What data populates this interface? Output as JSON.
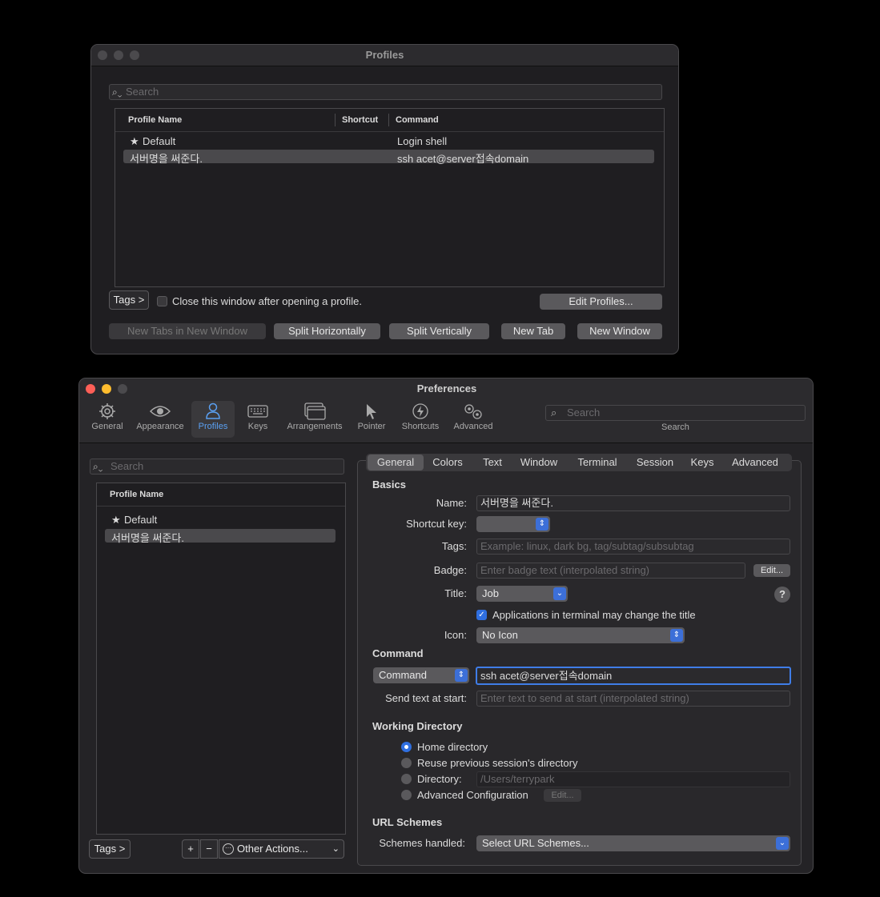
{
  "profiles_window": {
    "title": "Profiles",
    "search_placeholder": "Search",
    "columns": {
      "name": "Profile Name",
      "shortcut": "Shortcut",
      "command": "Command"
    },
    "rows": [
      {
        "star": "★",
        "name": "Default",
        "command": "Login shell"
      },
      {
        "name": "서버명을 써준다.",
        "command": "ssh acet@server접속domain"
      }
    ],
    "tags_button": "Tags >",
    "close_checkbox_label": "Close this window after opening a profile.",
    "edit_profiles": "Edit Profiles...",
    "buttons": {
      "new_tabs_in_new_window": "New Tabs in New Window",
      "split_horizontally": "Split Horizontally",
      "split_vertically": "Split Vertically",
      "new_tab": "New Tab",
      "new_window": "New Window"
    }
  },
  "prefs_window": {
    "title": "Preferences",
    "toolbar": [
      {
        "label": "General",
        "icon": "gear-icon"
      },
      {
        "label": "Appearance",
        "icon": "eye-icon"
      },
      {
        "label": "Profiles",
        "icon": "person-icon"
      },
      {
        "label": "Keys",
        "icon": "keyboard-icon"
      },
      {
        "label": "Arrangements",
        "icon": "windows-icon"
      },
      {
        "label": "Pointer",
        "icon": "cursor-icon"
      },
      {
        "label": "Shortcuts",
        "icon": "bolt-icon"
      },
      {
        "label": "Advanced",
        "icon": "gears-icon"
      }
    ],
    "toolbar_search_placeholder": "Search",
    "toolbar_search_label": "Search",
    "sidebar": {
      "search_placeholder": "Search",
      "column": "Profile Name",
      "items": [
        {
          "star": "★",
          "name": "Default"
        },
        {
          "name": "서버명을 써준다."
        }
      ],
      "tags_button": "Tags >",
      "add": "+",
      "remove": "−",
      "other_actions": "Other Actions..."
    },
    "tabs": [
      "General",
      "Colors",
      "Text",
      "Window",
      "Terminal",
      "Session",
      "Keys",
      "Advanced"
    ],
    "basics": {
      "header": "Basics",
      "name_label": "Name:",
      "name_value": "서버명을 써준다.",
      "shortcut_label": "Shortcut key:",
      "tags_label": "Tags:",
      "tags_placeholder": "Example: linux, dark bg, tag/subtag/subsubtag",
      "badge_label": "Badge:",
      "badge_placeholder": "Enter badge text (interpolated string)",
      "badge_edit": "Edit...",
      "title_label": "Title:",
      "title_value": "Job",
      "help": "?",
      "apps_change_title": "Applications in terminal may change the title",
      "icon_label": "Icon:",
      "icon_value": "No Icon"
    },
    "command": {
      "header": "Command",
      "type_value": "Command",
      "command_value": "ssh acet@server접속domain",
      "send_text_label": "Send text at start:",
      "send_text_placeholder": "Enter text to send at start (interpolated string)"
    },
    "working_directory": {
      "header": "Working Directory",
      "home": "Home directory",
      "reuse": "Reuse previous session's directory",
      "directory": "Directory:",
      "directory_value": "/Users/terrypark",
      "advanced": "Advanced Configuration",
      "advanced_edit": "Edit..."
    },
    "url_schemes": {
      "header": "URL Schemes",
      "label": "Schemes handled:",
      "value": "Select URL Schemes..."
    }
  }
}
